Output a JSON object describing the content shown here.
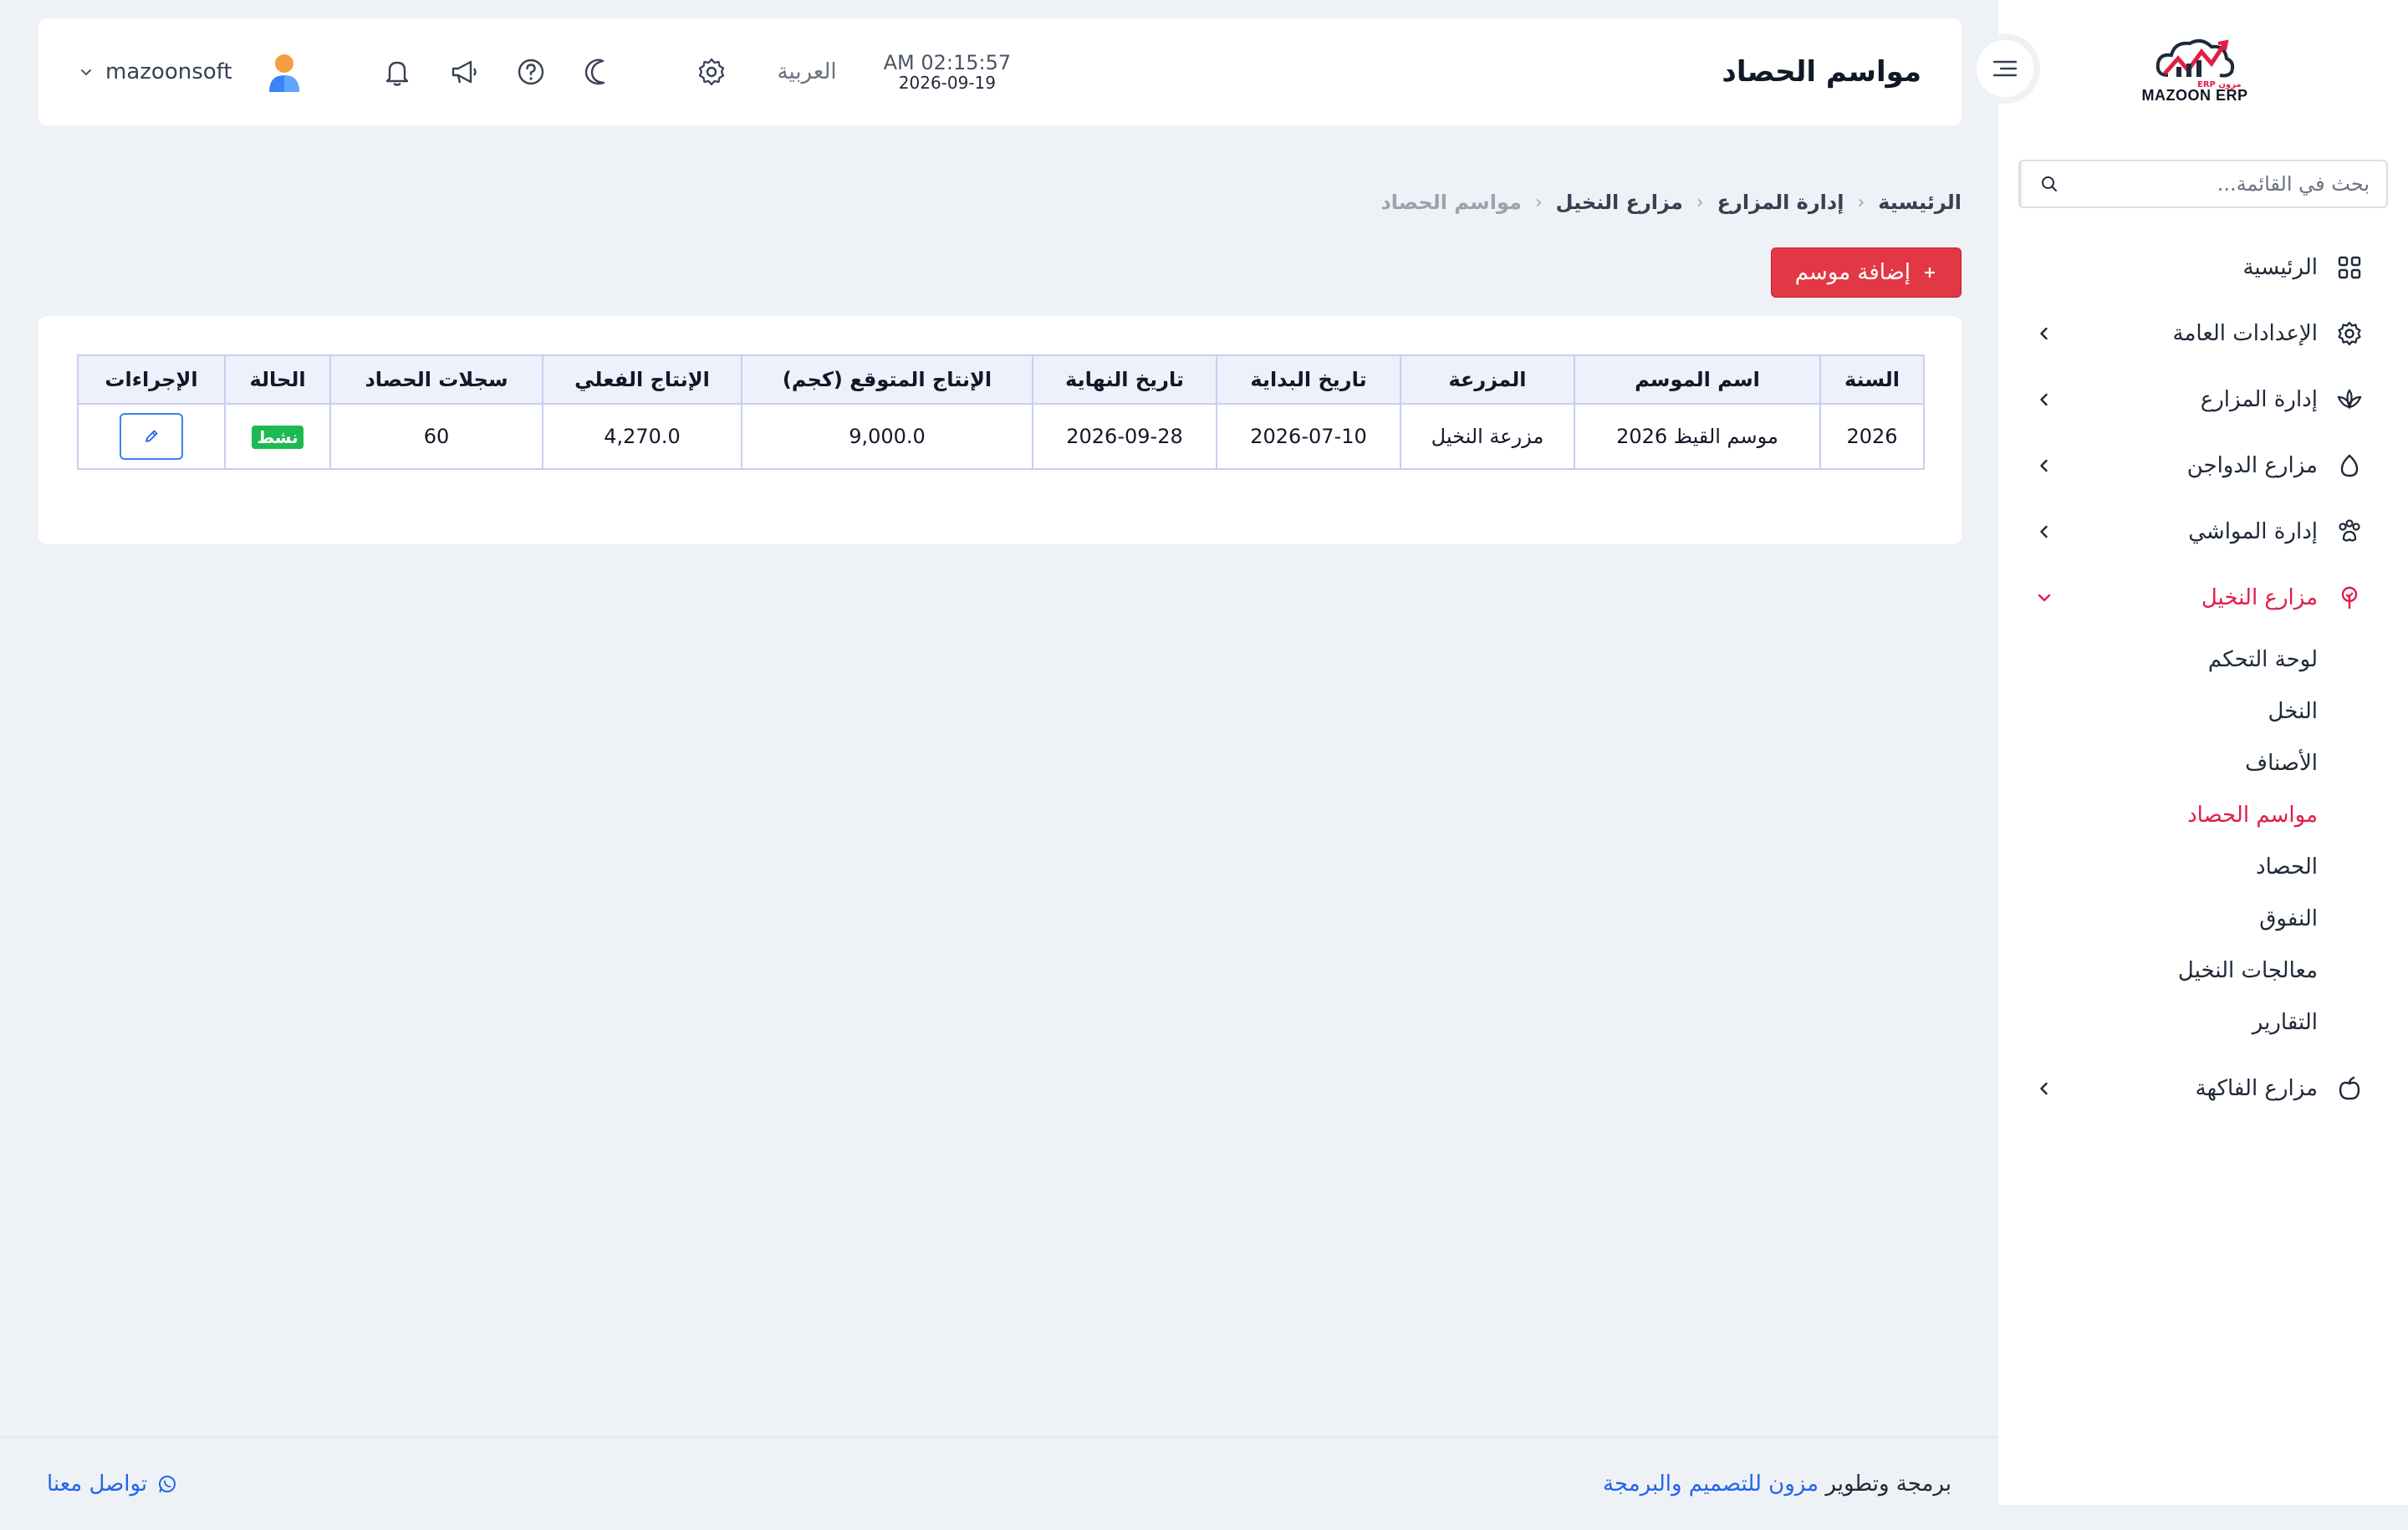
{
  "header": {
    "page_title": "مواسم الحصاد",
    "time": "AM 02:15:57",
    "date": "2026-09-19",
    "language": "العربية",
    "user_name": "mazoonsoft"
  },
  "sidebar": {
    "logo_text": "MAZOON ERP",
    "logo_sub": "مزون ERP",
    "search_placeholder": "بحث في القائمة...",
    "items": [
      {
        "label": "الرئيسية"
      },
      {
        "label": "الإعدادات العامة"
      },
      {
        "label": "إدارة المزارع"
      },
      {
        "label": "مزارع الدواجن"
      },
      {
        "label": "إدارة المواشي"
      },
      {
        "label": "مزارع النخيل"
      },
      {
        "label": "مزارع الفاكهة"
      }
    ],
    "palm_sub": [
      "لوحة التحكم",
      "النخل",
      "الأصناف",
      "مواسم الحصاد",
      "الحصاد",
      "النفوق",
      "معالجات النخيل",
      "التقارير"
    ]
  },
  "breadcrumb": [
    "الرئيسية",
    "إدارة المزارع",
    "مزارع النخيل",
    "مواسم الحصاد"
  ],
  "actions": {
    "add_label": "إضافة موسم"
  },
  "table": {
    "headers": [
      "السنة",
      "اسم الموسم",
      "المزرعة",
      "تاريخ البداية",
      "تاريخ النهاية",
      "الإنتاج المتوقع (كجم)",
      "الإنتاج الفعلي",
      "سجلات الحصاد",
      "الحالة",
      "الإجراءات"
    ],
    "rows": [
      [
        "2026",
        "موسم القيظ 2026",
        "مزرعة النخيل",
        "2026-07-10",
        "2026-09-28",
        "9,000.0",
        "4,270.0",
        "60",
        "نشط"
      ]
    ]
  },
  "footer": {
    "contact": "تواصل معنا",
    "credit_prefix": "برمجة وتطوير",
    "credit_link": "مزون للتصميم والبرمجة"
  },
  "colors": {
    "accent": "#e23744",
    "active_menu": "#e11d48",
    "status_active": "#1db954",
    "link": "#2563eb"
  }
}
